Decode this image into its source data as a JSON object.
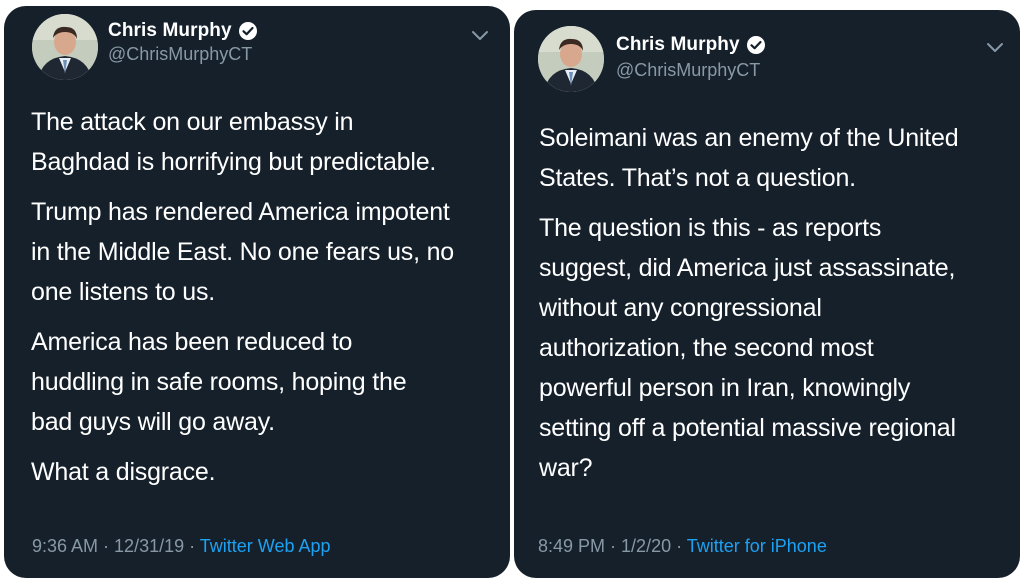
{
  "tweets": [
    {
      "author": {
        "name": "Chris Murphy",
        "handle": "@ChrisMurphyCT",
        "verified": true
      },
      "paragraphs": [
        [
          "The attack on our embassy in",
          "Baghdad is horrifying but predictable."
        ],
        [
          "Trump has rendered America impotent",
          "in the Middle East. No one fears us, no",
          "one listens to us."
        ],
        [
          "America has been reduced to",
          "huddling in safe rooms, hoping the",
          "bad guys will go away."
        ],
        [
          "What a disgrace."
        ]
      ],
      "time": "9:36 AM",
      "date": "12/31/19",
      "source": "Twitter Web App"
    },
    {
      "author": {
        "name": "Chris Murphy",
        "handle": "@ChrisMurphyCT",
        "verified": true
      },
      "paragraphs": [
        [
          "Soleimani was an enemy of the United",
          "States. That’s not a question."
        ],
        [
          "The question is this - as reports",
          "suggest, did America just assassinate,",
          "without any congressional",
          "authorization, the second most",
          "powerful person in Iran, knowingly",
          "setting off a potential massive regional",
          "war?"
        ]
      ],
      "time": "8:49 PM",
      "date": "1/2/20",
      "source": "Twitter for iPhone"
    }
  ],
  "separator": " · ",
  "icons": {
    "verified": "verified-badge-icon",
    "menu": "chevron-down-icon"
  },
  "colors": {
    "background": "#15202b",
    "text": "#ffffff",
    "muted": "#8899a6",
    "link": "#1da1f2"
  }
}
